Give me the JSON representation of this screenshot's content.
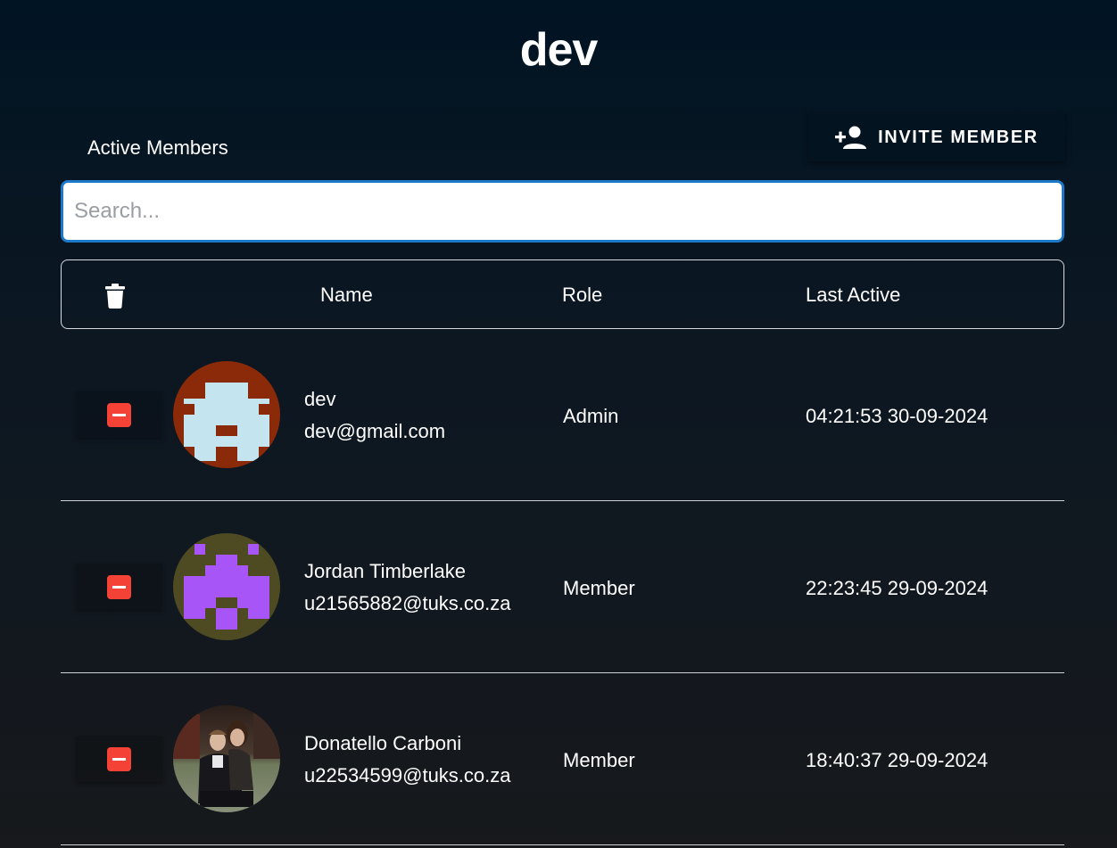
{
  "page": {
    "title": "dev"
  },
  "section": {
    "label": "Active Members"
  },
  "toolbar": {
    "invite_label": "INVITE MEMBER",
    "invite_icon": "person-add-icon"
  },
  "search": {
    "placeholder": "Search...",
    "value": ""
  },
  "table": {
    "columns": {
      "name": "Name",
      "role": "Role",
      "last_active": "Last Active"
    },
    "bulk_delete_icon": "trash-icon"
  },
  "members": [
    {
      "name": "dev",
      "email": "dev@gmail.com",
      "role": "Admin",
      "last_active": "04:21:53 30-09-2024",
      "avatar": "identicon-light-blue-on-rust"
    },
    {
      "name": "Jordan Timberlake",
      "email": "u21565882@tuks.co.za",
      "role": "Member",
      "last_active": "22:23:45 29-09-2024",
      "avatar": "identicon-purple-on-olive"
    },
    {
      "name": "Donatello Carboni",
      "email": "u22534599@tuks.co.za",
      "role": "Member",
      "last_active": "18:40:37 29-09-2024",
      "avatar": "photo-couple"
    }
  ],
  "colors": {
    "accent": "#1e78c8",
    "remove": "#f44336",
    "background_top": "#011423",
    "background_bottom": "#17191c"
  }
}
